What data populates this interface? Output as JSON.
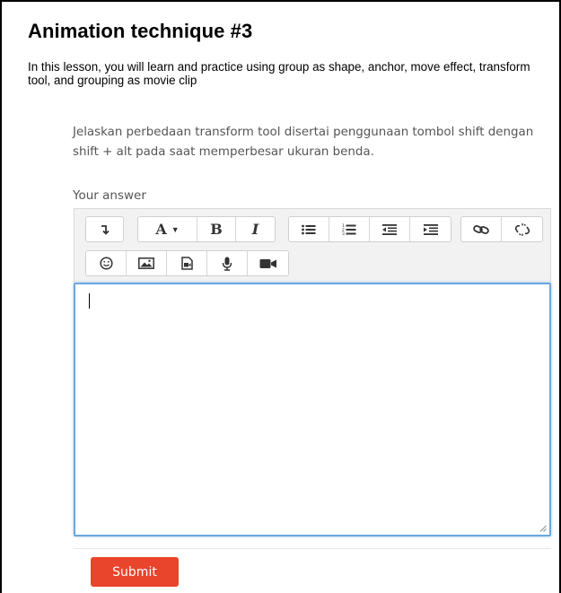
{
  "lesson": {
    "title": "Animation technique #3",
    "intro": "In this lesson, you will learn and practice using group as shape, anchor, move effect, transform tool, and grouping as movie clip"
  },
  "question": {
    "text": "Jelaskan perbedaan transform tool disertai penggunaan tombol shift dengan shift + alt pada saat memperbesar ukuran benda.",
    "answer_label": "Your answer"
  },
  "toolbar": {
    "row1": [
      "collapse-toolbar",
      "font-color",
      "bold",
      "italic",
      "unordered-list",
      "ordered-list",
      "outdent",
      "indent",
      "link",
      "unlink"
    ],
    "row2": [
      "emoticon",
      "image",
      "media",
      "record-audio",
      "record-video"
    ],
    "font_label": "A",
    "bold_label": "B",
    "italic_label": "I"
  },
  "editor": {
    "value": ""
  },
  "submit": {
    "label": "Submit"
  },
  "colors": {
    "accent": "#e8452c",
    "focus": "#6aa7e0",
    "toolbar_bg": "#f2f2f2"
  }
}
